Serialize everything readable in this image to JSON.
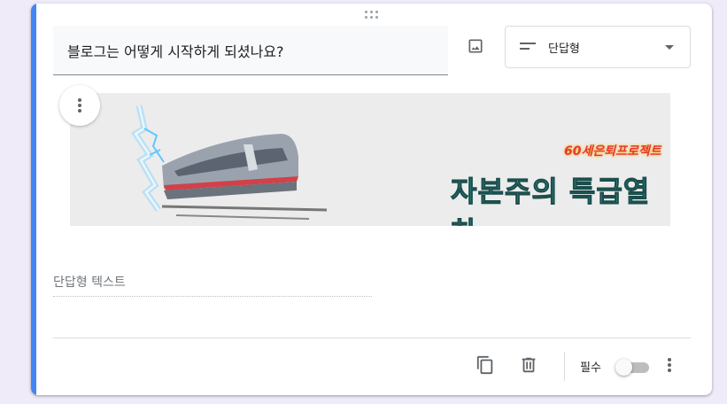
{
  "question": {
    "title": "블로그는 어떻게 시작하게 되셨나요?",
    "type_label": "단답형",
    "answer_placeholder": "단답형 텍스트"
  },
  "banner": {
    "tagline": "60세은퇴프로젝트",
    "title": "자본주의 특급열차"
  },
  "footer": {
    "required_label": "필수",
    "required_on": false
  },
  "colors": {
    "accent": "#4285f4",
    "background": "#efebf9",
    "banner_title": "#2f8f8c"
  },
  "icons": [
    "drag-handle-icon",
    "image-icon",
    "short-answer-icon",
    "dropdown-caret-icon",
    "more-vert-icon",
    "copy-icon",
    "trash-icon"
  ]
}
